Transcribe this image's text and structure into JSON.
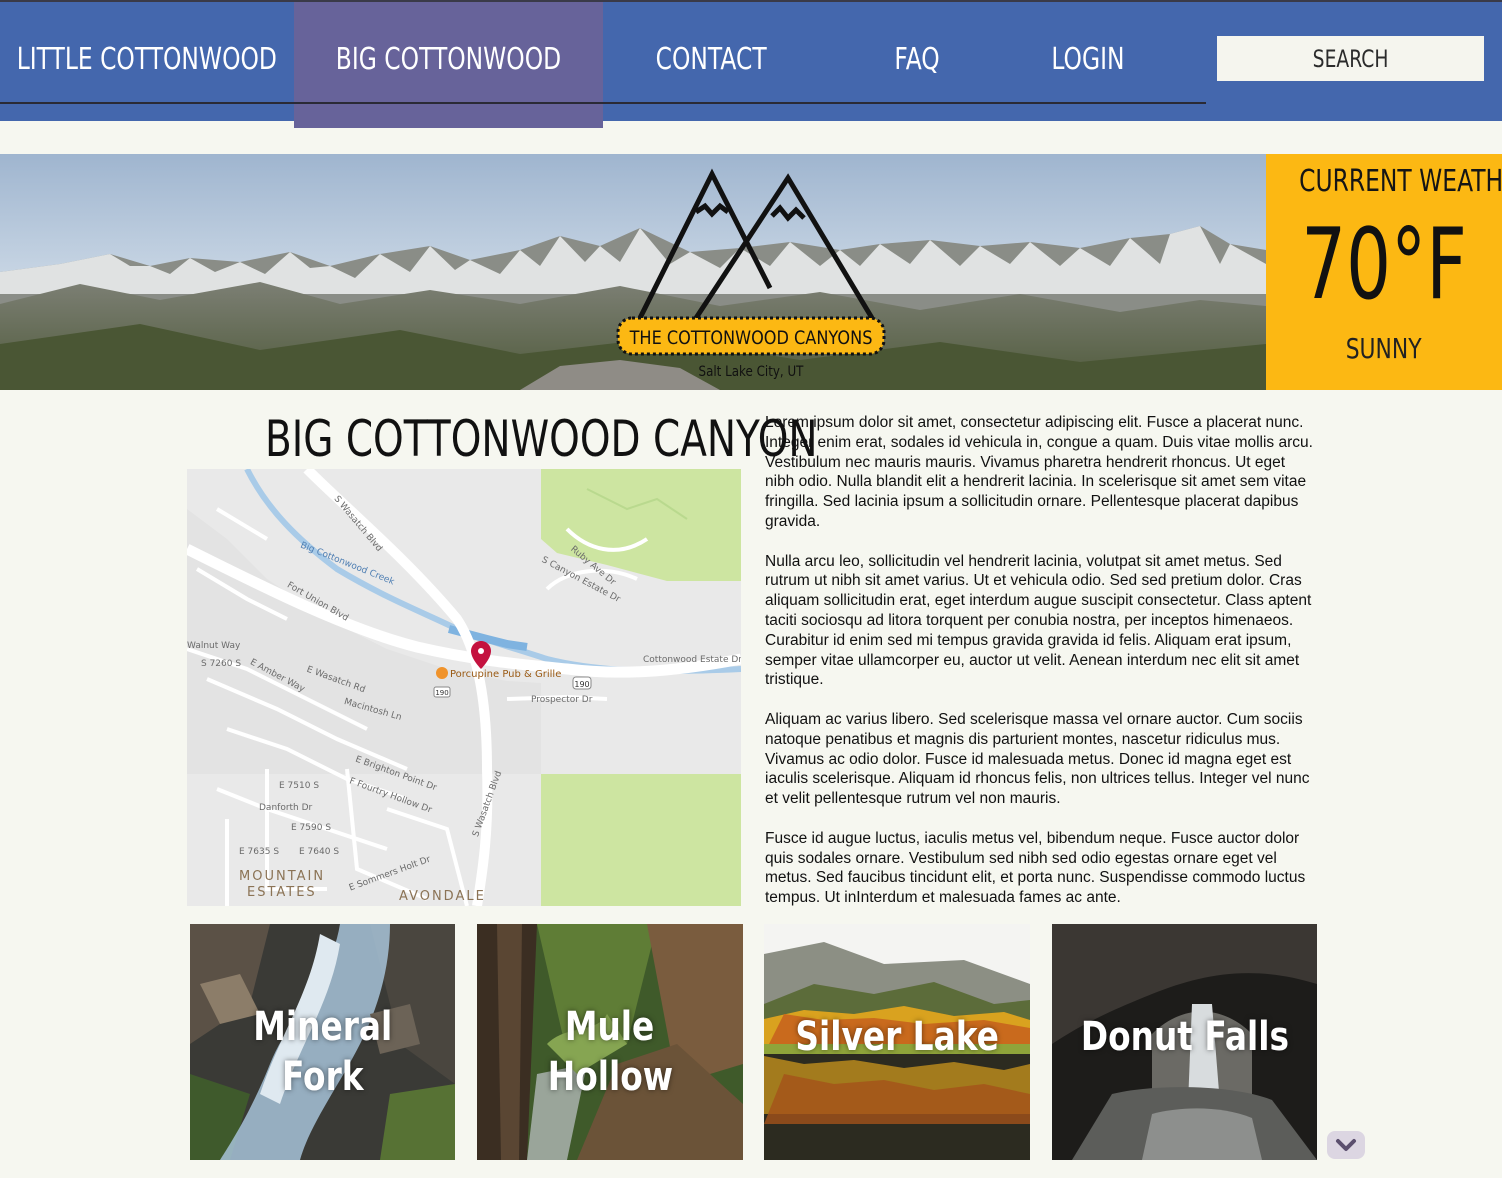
{
  "nav": {
    "items": [
      {
        "label": "LITTLE COTTONWOOD"
      },
      {
        "label": "BIG COTTONWOOD"
      },
      {
        "label": "CONTACT"
      },
      {
        "label": "FAQ"
      },
      {
        "label": "LOGIN"
      }
    ],
    "active_index": 1,
    "search_placeholder": "SEARCH"
  },
  "logo": {
    "name": "THE COTTONWOOD CANYONS",
    "location": "Salt Lake City, UT"
  },
  "weather": {
    "title": "CURRENT WEATHER",
    "temperature": "70°F",
    "condition": "SUNNY"
  },
  "main": {
    "title": "BIG COTTONWOOD CANYON",
    "map": {
      "poi": "Porcupine Pub & Grille",
      "route": "190",
      "labels": [
        "Big Cottonwood Creek",
        "S Wasatch Blvd",
        "Fort Union Blvd",
        "Walnut Way",
        "S 7260 S",
        "E Amber Way",
        "E Wasatch Rd",
        "Macintosh Ln",
        "E Brighton Point Dr",
        "F Fourtry Hollow Dr",
        "E 7510 S",
        "Danforth Dr",
        "E 7590 S",
        "E 7635 S",
        "E 7640 S",
        "E Sommers Holt Dr",
        "S Wasatch Blvd",
        "Prospector Dr",
        "Cottonwood Estate Dr",
        "S Canyon Estate Dr",
        "Ruby Ave Dr"
      ],
      "places": [
        "MOUNTAIN",
        "ESTATES",
        "AVONDALE"
      ]
    },
    "paragraphs": [
      "Lorem ipsum dolor sit amet, consectetur adipiscing elit. Fusce a placerat nunc. Integer enim erat, sodales id vehicula in, congue a quam. Duis vitae mollis arcu. Vestibulum nec mauris mauris. Vivamus pharetra hendrerit rhoncus. Ut eget nibh odio. Nulla blandit elit a hendrerit lacinia. In scelerisque sit amet sem vitae fringilla. Sed lacinia ipsum a sollicitudin ornare. Pellentesque placerat dapibus gravida.",
      "Nulla arcu leo, sollicitudin vel hendrerit lacinia, volutpat sit amet metus. Sed rutrum ut nibh sit amet varius. Ut et vehicula odio. Sed sed pretium dolor. Cras aliquam sollicitudin erat, eget interdum augue suscipit consectetur. Class aptent taciti sociosqu ad litora torquent per conubia nostra, per inceptos himenaeos. Curabitur id enim sed mi tempus gravida gravida id felis. Aliquam erat ipsum, semper vitae ullamcorper eu, auctor ut velit. Aenean interdum nec elit sit amet tristique.",
      "Aliquam ac varius libero. Sed scelerisque massa vel ornare auctor. Cum sociis natoque penatibus et magnis dis parturient montes, nascetur ridiculus mus. Vivamus ac odio dolor. Fusce id malesuada metus. Donec id magna eget est iaculis scelerisque. Aliquam id rhoncus felis, non ultrices tellus. Integer vel nunc et velit pellentesque rutrum vel non mauris.",
      "Fusce id augue luctus, iaculis metus vel, bibendum neque. Fusce auctor dolor quis sodales ornare. Vestibulum sed nibh sed odio egestas ornare eget vel metus. Sed faucibus tincidunt elit, et porta nunc. Suspendisse commodo luctus tempus. Ut inInterdum et malesuada fames ac ante."
    ]
  },
  "cards": [
    {
      "line1": "Mineral",
      "line2": "Fork"
    },
    {
      "line1": "Mule",
      "line2": "Hollow"
    },
    {
      "line1": "Silver Lake",
      "line2": ""
    },
    {
      "line1": "Donut Falls",
      "line2": ""
    }
  ],
  "colors": {
    "nav_bg": "#4467ad",
    "nav_active": "#67639a",
    "page_bg": "#f6f7f0",
    "weather_bg": "#fcb813"
  }
}
